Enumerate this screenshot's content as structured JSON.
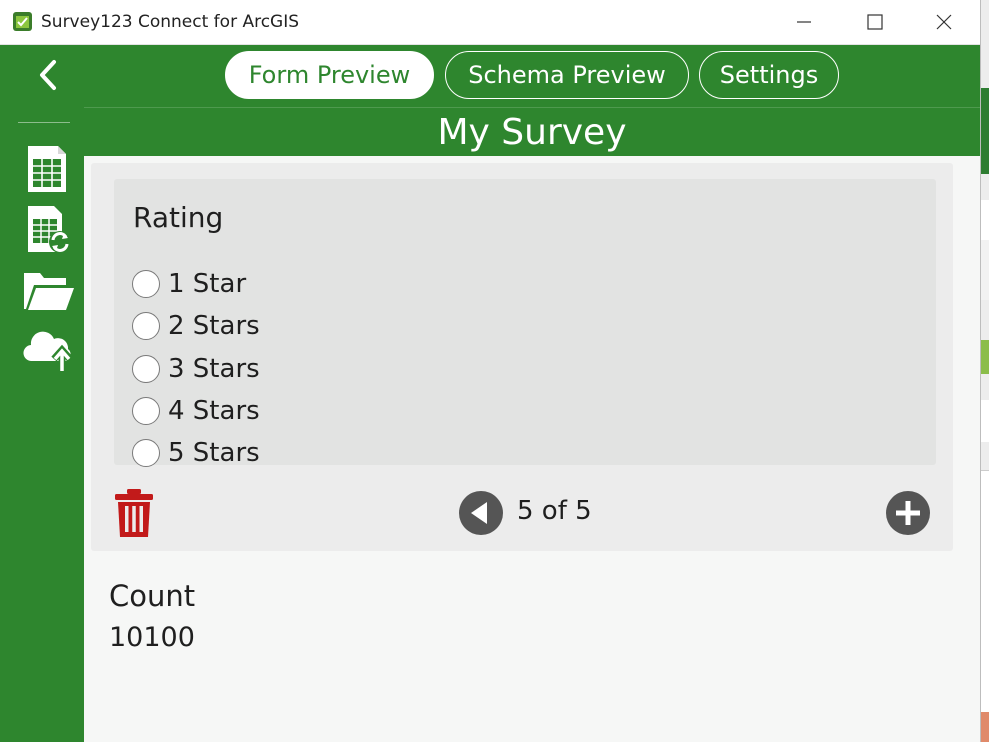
{
  "window": {
    "title": "Survey123 Connect for ArcGIS"
  },
  "tabs": [
    {
      "label": "Form Preview",
      "active": true
    },
    {
      "label": "Schema Preview",
      "active": false
    },
    {
      "label": "Settings",
      "active": false
    }
  ],
  "sidebar": {
    "icons": [
      "back-arrow-icon",
      "spreadsheet-icon",
      "spreadsheet-refresh-icon",
      "folder-icon",
      "cloud-upload-icon"
    ]
  },
  "form": {
    "title": "My Survey",
    "question": {
      "label": "Rating",
      "choices": [
        "1 Star",
        "2 Stars",
        "3 Stars",
        "4 Stars",
        "5 Stars"
      ]
    },
    "repeat": {
      "page_indicator": "5 of 5"
    },
    "count": {
      "label": "Count",
      "value": "10100"
    }
  },
  "colors": {
    "brand_green": "#2e862e",
    "delete_red": "#c21a1a",
    "nav_grey": "#555555"
  }
}
